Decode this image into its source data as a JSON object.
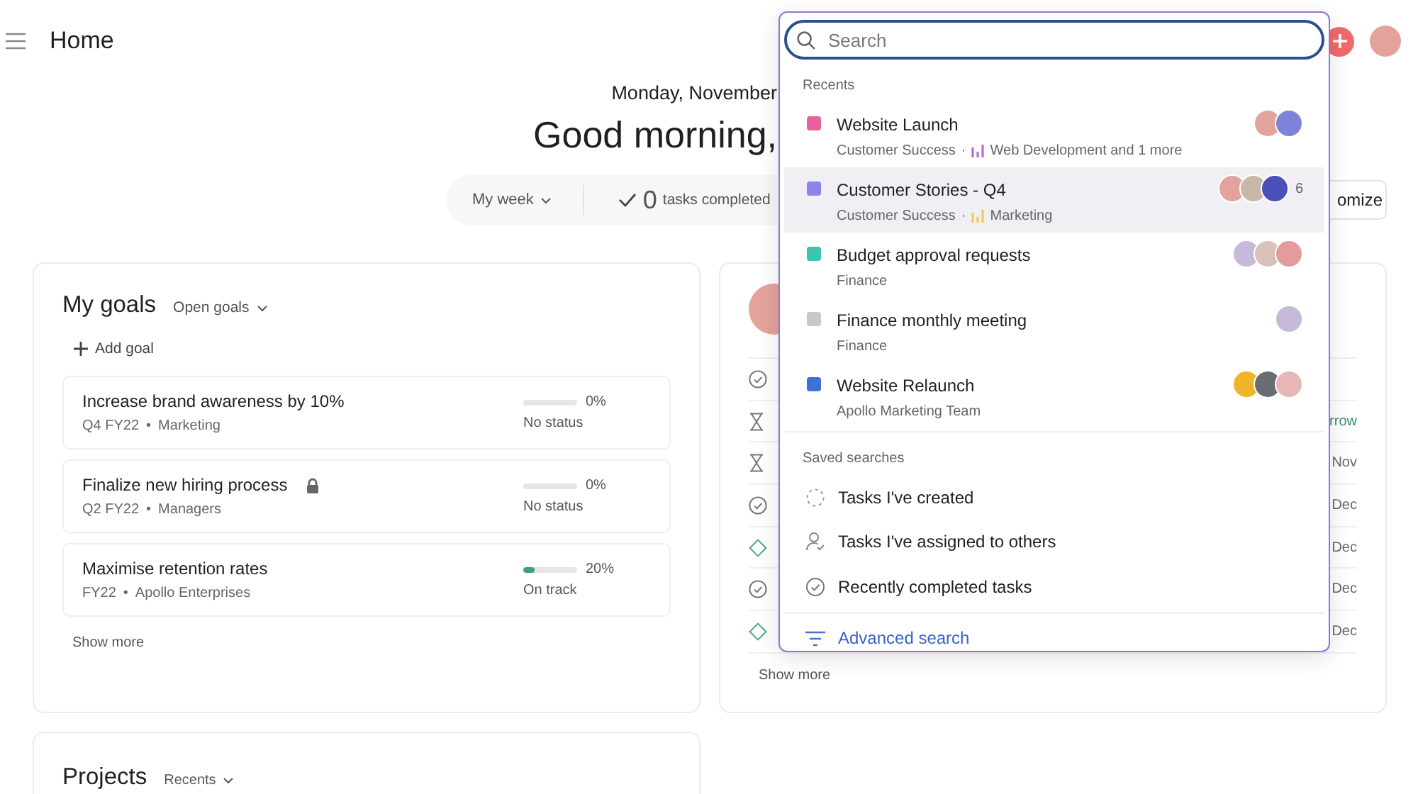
{
  "topbar": {
    "title": "Home"
  },
  "greeting": {
    "date": "Monday, November",
    "headline": "Good morning,"
  },
  "stats": {
    "period": "My week",
    "count": "0",
    "count_label": "tasks completed"
  },
  "customize_button": "omize",
  "goals": {
    "title": "My goals",
    "filter": "Open goals",
    "add_label": "Add goal",
    "items": [
      {
        "title": "Increase brand awareness by 10%",
        "locked": false,
        "period": "Q4 FY22",
        "separator": "•",
        "team": "Marketing",
        "level": 0,
        "percent": "0%",
        "status": "No status"
      },
      {
        "title": "Finalize new hiring process",
        "locked": true,
        "period": "Q2 FY22",
        "separator": "•",
        "team": "Managers",
        "level": 0,
        "percent": "0%",
        "status": "No status"
      },
      {
        "title": "Maximise retention rates",
        "locked": false,
        "period": "FY22",
        "separator": "•",
        "team": "Apollo Enterprises",
        "level": 0.2,
        "percent": "20%",
        "status": "On track",
        "color": "#3f9f7a"
      }
    ],
    "show_more": "Show more"
  },
  "tasks": {
    "rows": [
      {
        "kind": "done"
      },
      {
        "kind": "waiting",
        "due": "rrow",
        "due_soon": true
      },
      {
        "kind": "waiting",
        "due": "Nov",
        "due_soon": false
      },
      {
        "kind": "done",
        "due": "Dec",
        "due_soon": false
      },
      {
        "kind": "milestone",
        "due": "Dec",
        "due_soon": false
      },
      {
        "kind": "done",
        "due": "Dec",
        "due_soon": false
      },
      {
        "kind": "milestone",
        "due": "Dec",
        "due_soon": false
      }
    ],
    "show_more": "Show more"
  },
  "projects": {
    "title": "Projects",
    "filter": "Recents"
  },
  "search_dropdown": {
    "placeholder": "Search",
    "recents_label": "Recents",
    "recents": [
      {
        "title": "Website Launch",
        "color": "#e8619e",
        "team": "Customer Success",
        "separator": "·",
        "portfolio": {
          "name": "Web Development and 1 more",
          "color": "#b76ad6"
        },
        "avatars": [
          {
            "color": "#e3a39b"
          },
          {
            "color": "#7d84d8"
          }
        ],
        "selected": false
      },
      {
        "title": "Customer Stories - Q4",
        "color": "#8d84e8",
        "team": "Customer Success",
        "separator": "·",
        "portfolio": {
          "name": "Marketing",
          "color": "#f2c94c"
        },
        "avatars": [
          {
            "color": "#e3a39b"
          },
          {
            "color": "#c9b8a8"
          },
          {
            "color": "#4b4fb8"
          }
        ],
        "extra": "6",
        "selected": true
      },
      {
        "title": "Budget approval requests",
        "color": "#3cc4b0",
        "team": "Finance",
        "avatars": [
          {
            "color": "#c7b9d9"
          },
          {
            "color": "#d8c2b8"
          },
          {
            "color": "#e39b9b"
          }
        ],
        "selected": false
      },
      {
        "title": "Finance monthly meeting",
        "color": "#c8c8c8",
        "team": "Finance",
        "avatars": [
          {
            "color": "#c7b9d9"
          }
        ],
        "selected": false
      },
      {
        "title": "Website Relaunch",
        "color": "#3f6fd8",
        "team": "Apollo Marketing Team",
        "avatars": [
          {
            "color": "#f0b429"
          },
          {
            "color": "#6b6b73"
          },
          {
            "color": "#e7b7b7"
          }
        ],
        "selected": false
      }
    ],
    "saved_label": "Saved searches",
    "saved": [
      {
        "kind": "created",
        "label": "Tasks I've created"
      },
      {
        "kind": "assigned",
        "label": "Tasks I've assigned to others"
      },
      {
        "kind": "completed",
        "label": "Recently completed tasks"
      }
    ],
    "advanced": "Advanced search"
  }
}
